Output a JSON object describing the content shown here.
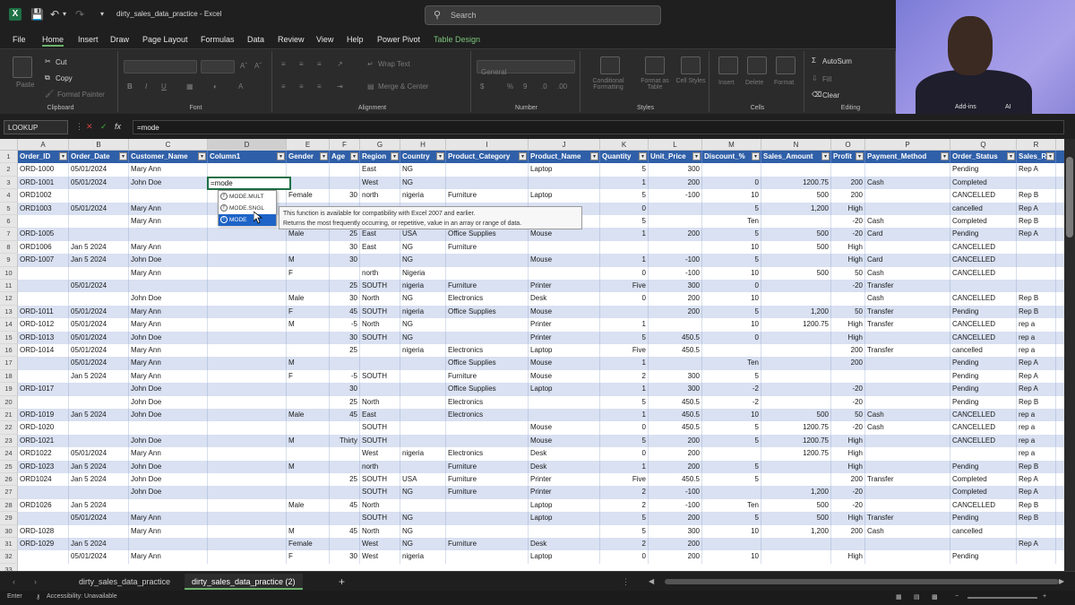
{
  "window": {
    "doc_title": "dirty_sales_data_practice  -  Excel",
    "search_placeholder": "Search"
  },
  "menu": [
    "File",
    "Home",
    "Insert",
    "Draw",
    "Page Layout",
    "Formulas",
    "Data",
    "Review",
    "View",
    "Help",
    "Power Pivot",
    "Table Design"
  ],
  "ribbon": {
    "clipboard": {
      "label": "Clipboard",
      "paste": "Paste",
      "cut": "Cut",
      "copy": "Copy",
      "format_painter": "Format Painter"
    },
    "font": {
      "label": "Font"
    },
    "alignment": {
      "label": "Alignment",
      "wrap": "Wrap Text",
      "merge": "Merge & Center"
    },
    "number": {
      "label": "Number",
      "format": "General"
    },
    "styles": {
      "label": "Styles",
      "cond": "Conditional Formatting",
      "table": "Format as Table",
      "cell": "Cell Styles"
    },
    "cells": {
      "label": "Cells",
      "insert": "Insert",
      "delete": "Delete",
      "format": "Format"
    },
    "editing": {
      "label": "Editing",
      "autosum": "AutoSum",
      "fill": "Fill",
      "clear": "Clear"
    },
    "addins": {
      "label": "Add-ins"
    },
    "ai": {
      "label": "AI"
    }
  },
  "formula_bar": {
    "name_box": "LOOKUP",
    "formula": "=mode"
  },
  "columns": {
    "letters": [
      "A",
      "B",
      "C",
      "D",
      "E",
      "F",
      "G",
      "H",
      "I",
      "J",
      "K",
      "L",
      "M",
      "N",
      "O",
      "P",
      "Q",
      "R"
    ],
    "headers": [
      "Order_ID",
      "Order_Date",
      "Customer_Name",
      "Column1",
      "Gender",
      "Age",
      "Region",
      "Country",
      "Product_Category",
      "Product_Name",
      "Quantity",
      "Unit_Price",
      "Discount_%",
      "Sales_Amount",
      "Profit",
      "Payment_Method",
      "Order_Status",
      "Sales_Re"
    ]
  },
  "row_numbers": [
    "1",
    "2",
    "3",
    "4",
    "5",
    "6",
    "7",
    "8",
    "9",
    "10",
    "11",
    "12",
    "13",
    "14",
    "15",
    "16",
    "17",
    "18",
    "19",
    "20",
    "21",
    "22",
    "23",
    "24",
    "25",
    "26",
    "27",
    "28",
    "29",
    "30",
    "31",
    "32",
    "33"
  ],
  "rows": [
    [
      "ORD-1000",
      "05/01/2024",
      "Mary Ann",
      "",
      "",
      "",
      "East",
      "NG",
      "",
      "Laptop",
      "5",
      "300",
      "",
      "",
      "",
      "",
      "Pending",
      "Rep A"
    ],
    [
      "ORD-1001",
      "05/01/2024",
      "John Doe",
      "=mode",
      "",
      "",
      "West",
      "NG",
      "",
      "",
      "1",
      "200",
      "0",
      "1200.75",
      "200",
      "Cash",
      "Completed",
      ""
    ],
    [
      "ORD1002",
      "",
      "",
      "",
      "Female",
      "30",
      "north",
      "nigeria",
      "Furniture",
      "Laptop",
      "5",
      "-100",
      "10",
      "500",
      "200",
      "",
      "CANCELLED",
      "Rep B"
    ],
    [
      "ORD1003",
      "05/01/2024",
      "Mary Ann",
      "",
      "",
      "",
      "",
      "",
      "",
      "",
      "0",
      "",
      "5",
      "1,200",
      "High",
      "",
      "cancelled",
      "Rep A"
    ],
    [
      "",
      "",
      "Mary Ann",
      "",
      "",
      "",
      "",
      "",
      "",
      "",
      "5",
      "",
      "Ten",
      "",
      "-20",
      "Cash",
      "Completed",
      "Rep B"
    ],
    [
      "ORD-1005",
      "",
      "",
      "",
      "Male",
      "25",
      "East",
      "USA",
      "Office Supplies",
      "Mouse",
      "1",
      "200",
      "5",
      "500",
      "-20",
      "Card",
      "Pending",
      "Rep A"
    ],
    [
      "ORD1006",
      "Jan 5 2024",
      "Mary Ann",
      "",
      "",
      "30",
      "East",
      "NG",
      "Furniture",
      "",
      "",
      "",
      "10",
      "500",
      "High",
      "",
      "CANCELLED",
      ""
    ],
    [
      "ORD-1007",
      "Jan 5 2024",
      "John Doe",
      "",
      "M",
      "30",
      "",
      "NG",
      "",
      "Mouse",
      "1",
      "-100",
      "5",
      "",
      "High",
      "Card",
      "CANCELLED",
      ""
    ],
    [
      "",
      "",
      "Mary Ann",
      "",
      "F",
      "",
      "north",
      "Nigeria",
      "",
      "",
      "0",
      "-100",
      "10",
      "500",
      "50",
      "Cash",
      "CANCELLED",
      ""
    ],
    [
      "",
      "05/01/2024",
      "",
      "",
      "",
      "25",
      "SOUTH",
      "nigeria",
      "Furniture",
      "Printer",
      "Five",
      "300",
      "0",
      "",
      "-20",
      "Transfer",
      "",
      ""
    ],
    [
      "",
      "",
      "John Doe",
      "",
      "Male",
      "30",
      "North",
      "NG",
      "Electronics",
      "Desk",
      "0",
      "200",
      "10",
      "",
      "",
      "Cash",
      "CANCELLED",
      "Rep B"
    ],
    [
      "ORD-1011",
      "05/01/2024",
      "Mary Ann",
      "",
      "F",
      "45",
      "SOUTH",
      "nigeria",
      "Office Supplies",
      "Mouse",
      "",
      "200",
      "5",
      "1,200",
      "50",
      "Transfer",
      "Pending",
      "Rep B"
    ],
    [
      "ORD-1012",
      "05/01/2024",
      "Mary Ann",
      "",
      "M",
      "-5",
      "North",
      "NG",
      "",
      "Printer",
      "1",
      "",
      "10",
      "1200.75",
      "High",
      "Transfer",
      "CANCELLED",
      "rep a"
    ],
    [
      "ORD-1013",
      "05/01/2024",
      "John Doe",
      "",
      "",
      "30",
      "SOUTH",
      "NG",
      "",
      "Printer",
      "5",
      "450.5",
      "0",
      "",
      "High",
      "",
      "CANCELLED",
      "rep a"
    ],
    [
      "ORD-1014",
      "05/01/2024",
      "Mary Ann",
      "",
      "",
      "25",
      "",
      "nigeria",
      "Electronics",
      "Laptop",
      "Five",
      "450.5",
      "",
      "",
      "200",
      "Transfer",
      "cancelled",
      "rep a"
    ],
    [
      "",
      "05/01/2024",
      "Mary Ann",
      "",
      "M",
      "",
      "",
      "",
      "Office Supplies",
      "Mouse",
      "1",
      "",
      "Ten",
      "",
      "200",
      "",
      "Pending",
      "Rep A"
    ],
    [
      "",
      "Jan 5 2024",
      "Mary Ann",
      "",
      "F",
      "-5",
      "SOUTH",
      "",
      "Furniture",
      "Mouse",
      "2",
      "300",
      "5",
      "",
      "",
      "",
      "Pending",
      "Rep A"
    ],
    [
      "ORD-1017",
      "",
      "John Doe",
      "",
      "",
      "30",
      "",
      "",
      "Office Supplies",
      "Laptop",
      "1",
      "300",
      "-2",
      "",
      "-20",
      "",
      "Pending",
      "Rep A"
    ],
    [
      "",
      "",
      "John Doe",
      "",
      "",
      "25",
      "North",
      "",
      "Electronics",
      "",
      "5",
      "450.5",
      "-2",
      "",
      "-20",
      "",
      "Pending",
      "Rep B"
    ],
    [
      "ORD-1019",
      "Jan 5 2024",
      "John Doe",
      "",
      "Male",
      "45",
      "East",
      "",
      "Electronics",
      "",
      "1",
      "450.5",
      "10",
      "500",
      "50",
      "Cash",
      "CANCELLED",
      "rep a"
    ],
    [
      "ORD-1020",
      "",
      "",
      "",
      "",
      "",
      "SOUTH",
      "",
      "",
      "Mouse",
      "0",
      "450.5",
      "5",
      "1200.75",
      "-20",
      "Cash",
      "CANCELLED",
      "rep a"
    ],
    [
      "ORD-1021",
      "",
      "John Doe",
      "",
      "M",
      "Thirty",
      "SOUTH",
      "",
      "",
      "Mouse",
      "5",
      "200",
      "5",
      "1200.75",
      "High",
      "",
      "CANCELLED",
      "rep a"
    ],
    [
      "ORD1022",
      "05/01/2024",
      "Mary Ann",
      "",
      "",
      "",
      "West",
      "nigeria",
      "Electronics",
      "Desk",
      "0",
      "200",
      "",
      "1200.75",
      "High",
      "",
      "",
      "rep a"
    ],
    [
      "ORD-1023",
      "Jan 5 2024",
      "John Doe",
      "",
      "M",
      "",
      "north",
      "",
      "Furniture",
      "Desk",
      "1",
      "200",
      "5",
      "",
      "High",
      "",
      "Pending",
      "Rep B"
    ],
    [
      "ORD1024",
      "Jan 5 2024",
      "John Doe",
      "",
      "",
      "25",
      "SOUTH",
      "USA",
      "Furniture",
      "Printer",
      "Five",
      "450.5",
      "5",
      "",
      "200",
      "Transfer",
      "Completed",
      "Rep A"
    ],
    [
      "",
      "",
      "John Doe",
      "",
      "",
      "",
      "SOUTH",
      "NG",
      "Furniture",
      "Printer",
      "2",
      "-100",
      "",
      "1,200",
      "-20",
      "",
      "Completed",
      "Rep A"
    ],
    [
      "ORD1026",
      "Jan 5 2024",
      "",
      "",
      "Male",
      "45",
      "North",
      "",
      "",
      "Laptop",
      "2",
      "-100",
      "Ten",
      "500",
      "-20",
      "",
      "CANCELLED",
      "Rep B"
    ],
    [
      "",
      "05/01/2024",
      "Mary Ann",
      "",
      "",
      "",
      "SOUTH",
      "NG",
      "",
      "Laptop",
      "5",
      "200",
      "5",
      "500",
      "High",
      "Transfer",
      "Pending",
      "Rep B"
    ],
    [
      "ORD-1028",
      "",
      "Mary Ann",
      "",
      "M",
      "45",
      "North",
      "NG",
      "",
      "",
      "5",
      "300",
      "10",
      "1,200",
      "200",
      "Cash",
      "cancelled",
      ""
    ],
    [
      "ORD-1029",
      "Jan 5 2024",
      "",
      "",
      "Female",
      "",
      "West",
      "NG",
      "Furniture",
      "Desk",
      "2",
      "200",
      "",
      "",
      "",
      "",
      "",
      "Rep A"
    ],
    [
      "",
      "05/01/2024",
      "Mary Ann",
      "",
      "F",
      "30",
      "West",
      "nigeria",
      "",
      "Laptop",
      "0",
      "200",
      "10",
      "",
      "High",
      "",
      "Pending",
      ""
    ]
  ],
  "autocomplete": {
    "items": [
      "MODE.MULT",
      "MODE.SNGL",
      "MODE"
    ],
    "tooltip_line1": "This function is available for compatibility with Excel 2007 and earlier.",
    "tooltip_line2": "Returns the most frequently occurring, or repetitive, value in an array or range of data."
  },
  "sheets": [
    "dirty_sales_data_practice",
    "dirty_sales_data_practice (2)"
  ],
  "status": {
    "mode": "Enter",
    "accessibility": "Accessibility: Unavailable"
  },
  "colors": {
    "header_blue": "#2f5fa8",
    "band_blue": "#d9e1f2",
    "excel_green": "#1e7145"
  }
}
